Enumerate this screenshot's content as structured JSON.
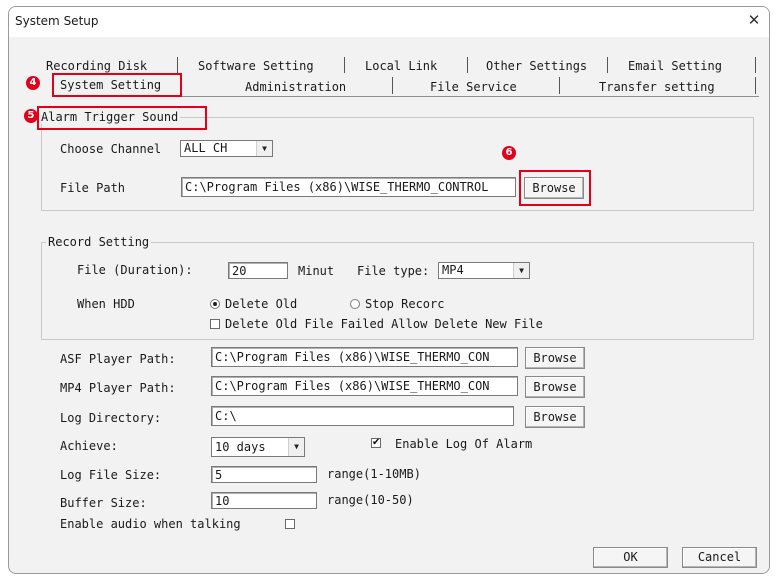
{
  "window": {
    "title": "System Setup",
    "close_symbol": "✕"
  },
  "tabs_row1": [
    "Recording Disk",
    "Software Setting",
    "Local Link",
    "Other Settings",
    "Email Setting"
  ],
  "tabs_row2": [
    "System Setting",
    "Administration",
    "File Service",
    "Transfer setting"
  ],
  "markers": {
    "m4": "4",
    "m5": "5",
    "m6": "6"
  },
  "alarm": {
    "legend": "Alarm Trigger Sound",
    "channel_label": "Choose Channel",
    "channel_value": "ALL CH",
    "path_label": "File Path",
    "path_value": "C:\\Program Files (x86)\\WISE_THERMO_CONTROL",
    "browse": "Browse"
  },
  "record": {
    "legend": "Record Setting",
    "duration_label": "File (Duration):",
    "duration_value": "20",
    "duration_unit": "Minut",
    "filetype_label": "File type:",
    "filetype_value": "MP4",
    "hdd_label": "When HDD",
    "delete_old": "Delete Old",
    "stop_record": "Stop Recorc",
    "delete_failed": "Delete Old File Failed Allow Delete New File"
  },
  "paths": {
    "asf_label": "ASF Player Path:",
    "asf_value": "C:\\Program Files (x86)\\WISE_THERMO_CON",
    "mp4_label": "MP4 Player Path:",
    "mp4_value": "C:\\Program Files (x86)\\WISE_THERMO_CON",
    "log_label": "Log Directory:",
    "log_value": "C:\\",
    "browse": "Browse"
  },
  "achieve": {
    "label": "Achieve:",
    "value": "10 days",
    "enable_log": "Enable Log Of Alarm",
    "enable_log_checked": true
  },
  "logsize": {
    "label": "Log File Size:",
    "value": "5",
    "range": "range(1-10MB)"
  },
  "buffer": {
    "label": "Buffer Size:",
    "value": "10",
    "range": "range(10-50)"
  },
  "audio": {
    "label": "Enable audio when talking",
    "checked": false
  },
  "footer": {
    "ok": "OK",
    "cancel": "Cancel"
  },
  "colors": {
    "annotation_red": "#e3001b",
    "dialog_bg": "#f2f2f2"
  }
}
